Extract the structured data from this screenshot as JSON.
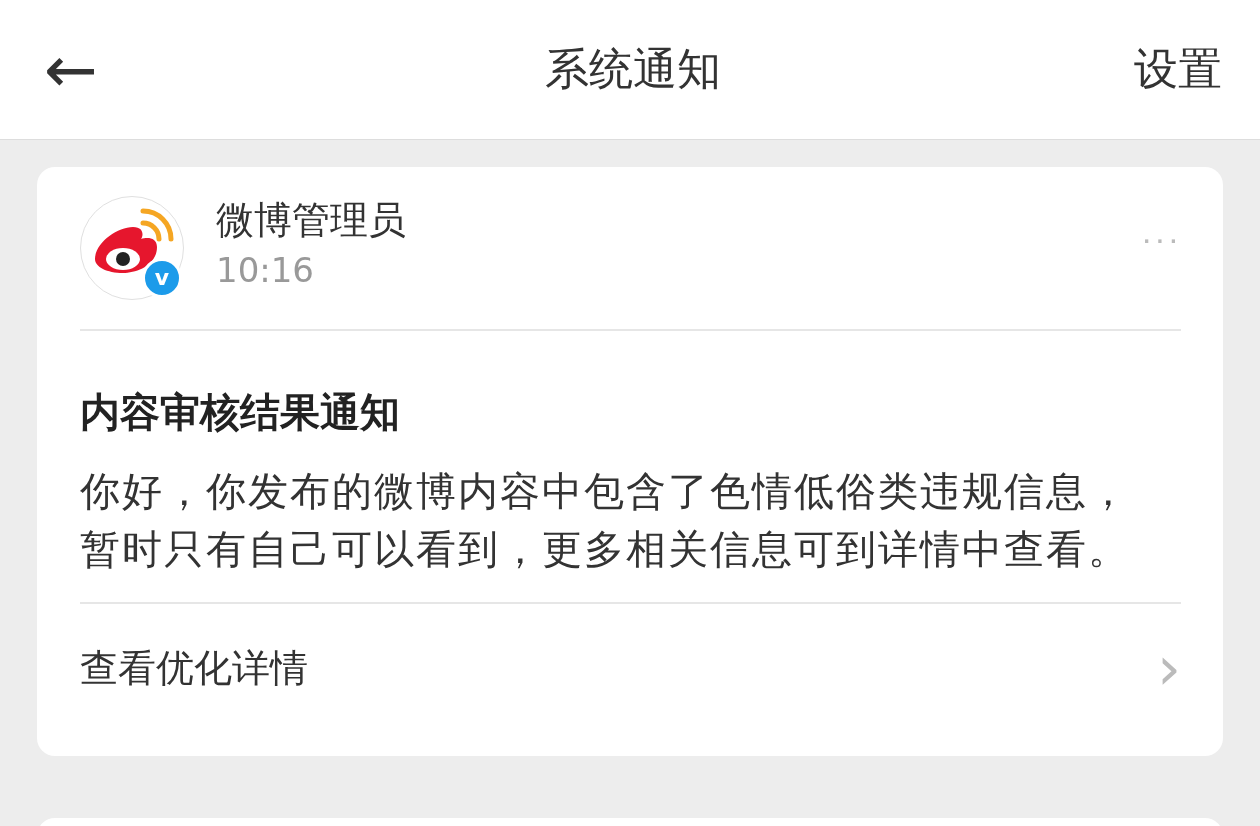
{
  "header": {
    "back": "←",
    "title": "系统通知",
    "action": "设置"
  },
  "notification": {
    "sender": "微博管理员",
    "time": "10:16",
    "verified_badge": "v",
    "more": "···",
    "title": "内容审核结果通知",
    "body": "你好，你发布的微博内容中包含了色情低俗类违规信息，暂时只有自己可以看到，更多相关信息可到详情中查看。",
    "link": "查看优化详情",
    "link_arrow": "›"
  }
}
